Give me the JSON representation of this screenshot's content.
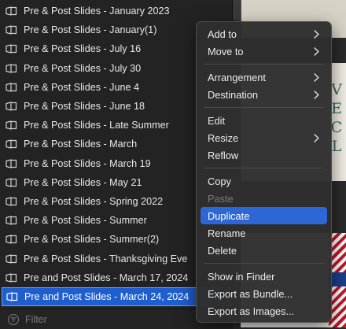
{
  "sidebar": {
    "items": [
      {
        "label": "Pre & Post Slides - January 2023"
      },
      {
        "label": "Pre & Post Slides - January(1)"
      },
      {
        "label": "Pre & Post Slides - July 16"
      },
      {
        "label": "Pre & Post Slides - July 30"
      },
      {
        "label": "Pre & Post Slides - June 4"
      },
      {
        "label": "Pre & Post Slides - June 18"
      },
      {
        "label": "Pre & Post Slides - Late Summer"
      },
      {
        "label": "Pre & Post Slides - March"
      },
      {
        "label": "Pre & Post Slides - March 19"
      },
      {
        "label": "Pre & Post Slides - May 21"
      },
      {
        "label": "Pre & Post Slides - Spring 2022"
      },
      {
        "label": "Pre & Post Slides - Summer"
      },
      {
        "label": "Pre & Post Slides - Summer(2)"
      },
      {
        "label": "Pre & Post Slides - Thanksgiving Eve"
      },
      {
        "label": "Pre and Post Slides - March 17, 2024"
      },
      {
        "label": "Pre and Post Slides - March 24, 2024",
        "selected": true
      }
    ],
    "item_icon": "presentation-doc-icon",
    "filter": {
      "placeholder": "Filter",
      "icon": "filter-icon"
    }
  },
  "preview": {
    "letters": [
      "V",
      "E",
      "C",
      "L"
    ]
  },
  "context_menu": {
    "groups": [
      [
        {
          "label": "Add to",
          "submenu": true
        },
        {
          "label": "Move to",
          "submenu": true
        }
      ],
      [
        {
          "label": "Arrangement",
          "submenu": true
        },
        {
          "label": "Destination",
          "submenu": true
        }
      ],
      [
        {
          "label": "Edit"
        },
        {
          "label": "Resize",
          "submenu": true
        },
        {
          "label": "Reflow"
        }
      ],
      [
        {
          "label": "Copy"
        },
        {
          "label": "Paste",
          "disabled": true
        },
        {
          "label": "Duplicate",
          "highlighted": true
        },
        {
          "label": "Rename"
        },
        {
          "label": "Delete"
        }
      ],
      [
        {
          "label": "Show in Finder"
        },
        {
          "label": "Export as Bundle..."
        },
        {
          "label": "Export as Images..."
        }
      ]
    ]
  },
  "colors": {
    "selection": "#1f5ecf",
    "menu_highlight": "#2d67d6",
    "menu_background": "#2e2e2e",
    "sidebar_background": "#232323"
  }
}
